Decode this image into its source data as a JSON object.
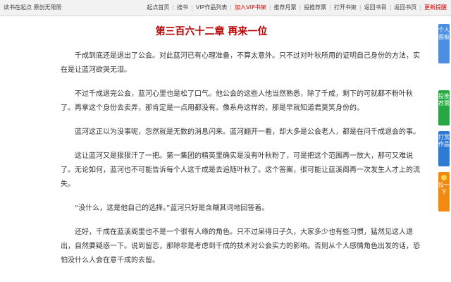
{
  "topbar": {
    "left_text": "读书在起点 原创无限限",
    "nav": [
      {
        "label": "起点首页",
        "accent": false
      },
      {
        "label": "搜书",
        "accent": false
      },
      {
        "label": "VIP作品列表",
        "accent": false
      },
      {
        "label": "加入VIP书架",
        "accent": true
      },
      {
        "label": "推荐月票",
        "accent": false
      },
      {
        "label": "投推荐票",
        "accent": false
      },
      {
        "label": "打开书架",
        "accent": false
      },
      {
        "label": "返回书目",
        "accent": false
      },
      {
        "label": "返回书页",
        "accent": false
      },
      {
        "label": "更新提醒",
        "accent": true
      }
    ]
  },
  "chapter": {
    "title": "第三百六十二章 再来一位",
    "paragraphs": [
      "千成到底还是退出了公会。对此蓝河已有心理准备，不算太意外。只不过对叶秋所用的证明自己身份的方法，实在是让蓝河欲哭无泪。",
      "不过千成退完公会，蓝河心里也是松了口气。他公会的这些人他当然熟悉，除了千成，剩下的可就都不粉叶秋了。再拿这个身份去卖弄，那肯定是一点用都没有。像系舟这样的，那是早就知道君莫笑身份的。",
      "蓝河这正以为没事呢，忽然就是无数的消息闪来。蓝河翻开一看，却大多是公会老人，都是在问千成退会的事。",
      "这让蓝河又是狠狠汗了一把。第一集团的精英里确实是没有叶秋粉了，可是把这个范围再一放大，那可又难说了。无论如何，蓝河也不可能告诉每个人这千成是去追随叶秋了。这个答案，很可能让蓝溪阁再一次发生人才上的流失。",
      "“没什么，这是他自己的选择。”蓝河只好是含糊其词地回答着。",
      "还好，千成在蓝溪阁里也不是一个很有人缘的角色。只不过呆得日子久，大家多少也有些习惯，猛然见这人退出，自然要疑惑一下。说到留恋，那除非是考虑到千成的技术对公会实力的影响。否则从个人感情角色出发的话，恐怕没什么人会在意千成的去留。"
    ]
  },
  "side_tabs": {
    "personal": {
      "label": "个人面板",
      "color": "#4d8ee0"
    },
    "recommend": {
      "label": "投推荐票",
      "color": "#27a844"
    },
    "reward": {
      "label": "打赏作品",
      "color": "#2f7ad3"
    },
    "ticket": {
      "label": "投一下",
      "color": "#f08a12",
      "icon": "ticket-icon"
    }
  }
}
